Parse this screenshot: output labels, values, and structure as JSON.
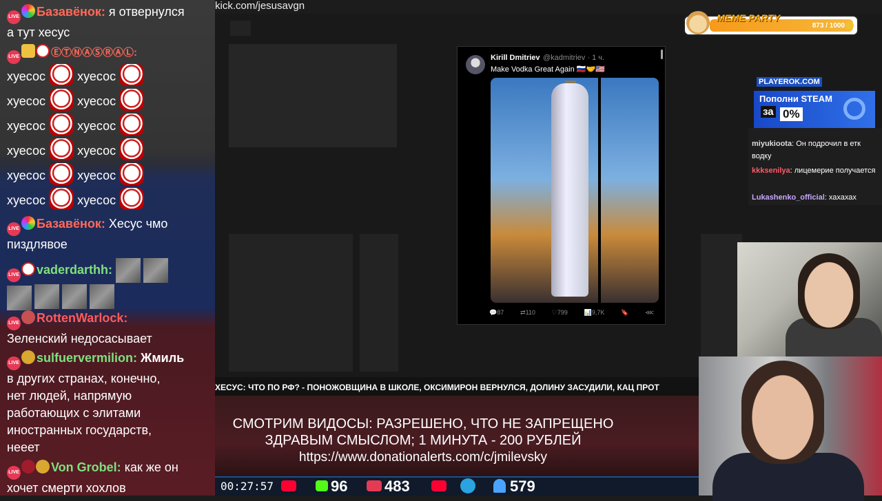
{
  "chat": {
    "m1": {
      "nick": "Базавёнок:",
      "nick_color": "#ff6a5a",
      "text": "я отвернулся",
      "text2": "а тут хесус"
    },
    "m2": {
      "nick": "ⒺⓉⓃⒶⓈⓇⒶⓁ:",
      "nick_color": "#ff6a5a",
      "word": "хуесос"
    },
    "m3": {
      "nick": "Базавёнок:",
      "nick_color": "#ff6a5a",
      "text": "Хесус чмо",
      "text2": "пиздлявое"
    },
    "m4": {
      "nick": "vaderdarthh:",
      "nick_color": "#7fe07f"
    },
    "m5": {
      "nick": "RottenWarlock:",
      "nick_color": "#ff5a5a",
      "text": "Зеленский недосасывает"
    },
    "m6": {
      "nick": "sulfuervermilion:",
      "nick_color": "#7fe07f",
      "text": "Жмиль",
      "lines": [
        "в других странах, конечно,",
        "нет людей, напрямую",
        "работающих с элитами",
        "иностранных государств,",
        "нееет"
      ]
    },
    "m7": {
      "nick": "Von Grobel:",
      "nick_color": "#7fe07f",
      "text": "как же он",
      "text2": "хочет смерти хохлов"
    },
    "live": "LIVE"
  },
  "url": "kick.com/jesusavgn",
  "tweet": {
    "name": "Kirill Dmitriev",
    "handle": "@kadmitriev · 1 ч.",
    "text": "Make Vodka Great Again 🇷🇺🤝🇺🇸",
    "replies": "87",
    "reposts": "110",
    "likes": "799",
    "views": "9,7K"
  },
  "meme_party": {
    "title": "MEME PARTY",
    "count": "873 / 1000"
  },
  "playerok": {
    "logo": "PLAYEROK.COM",
    "text": "Пополни STEAM",
    "za": "за",
    "pct": "0%"
  },
  "right_chat": [
    {
      "nick": "miyukioota",
      "color": "#dddddd",
      "text": ": Он подрочил в етк водку"
    },
    {
      "nick": "kkksenilya",
      "color": "#ff5a6a",
      "text": ": лицемерие получается"
    },
    {
      "nick": "Lukashenko_official",
      "color": "#c8a8ff",
      "text": ": хахахах"
    }
  ],
  "ticker": "ХЕСУС: ЧТО ПО РФ? - ПОНОЖОВЩИНА В ШКОЛЕ, ОКСИМИРОН ВЕРНУЛСЯ, ДОЛИНУ ЗАСУДИЛИ, КАЦ ПРОТ",
  "donation": {
    "line1": "СМОТРИМ ВИДОСЫ: РАЗРЕШЕНО, ЧТО НЕ ЗАПРЕЩЕНО",
    "line2": "ЗДРАВЫМ СМЫСЛОМ; 1 МИНУТА - 200 РУБЛЕЙ",
    "line3": "https://www.donationalerts.com/c/jmilevsky"
  },
  "stats": {
    "timer": "00:27:57",
    "kick": "96",
    "vk": "483",
    "viewers": "579"
  },
  "colors": {
    "kick_green": "#53fc18",
    "vk_red": "#e53a55",
    "youtube_red": "#ff0033",
    "telegram": "#2aa3e0",
    "viewers_blue": "#4aa3ff"
  }
}
